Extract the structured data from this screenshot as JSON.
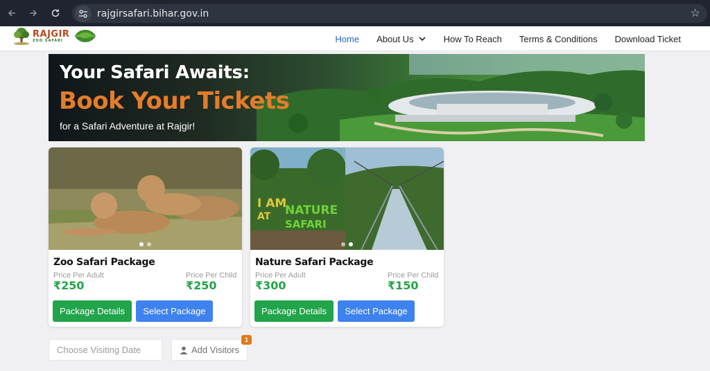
{
  "browser": {
    "url": "rajgirsafari.bihar.gov.in",
    "back_icon": "arrow-left-icon",
    "forward_icon": "arrow-right-icon",
    "reload_icon": "reload-icon",
    "site_info_icon": "tune-icon",
    "bookmark_icon": "star-icon"
  },
  "header": {
    "logo_main": "RAJGIR",
    "logo_sub": "ZOO SAFARI",
    "nav": [
      {
        "label": "Home",
        "active": true
      },
      {
        "label": "About Us",
        "has_dropdown": true
      },
      {
        "label": "How To Reach"
      },
      {
        "label": "Terms & Conditions"
      },
      {
        "label": "Download Ticket"
      }
    ]
  },
  "banner": {
    "line1": "Your Safari Awaits:",
    "line2": "Book Your Tickets",
    "line3": "for a Safari Adventure at Rajgir!"
  },
  "packages": [
    {
      "title": "Zoo Safari Package",
      "adult_label": "Price Per Adult",
      "adult_price": "₹250",
      "child_label": "Price Per Child",
      "child_price": "₹250",
      "details_button": "Package Details",
      "select_button": "Select Package"
    },
    {
      "title": "Nature Safari Package",
      "adult_label": "Price Per Adult",
      "adult_price": "₹300",
      "child_label": "Price Per Child",
      "child_price": "₹150",
      "details_button": "Package Details",
      "select_button": "Select Package",
      "image_sign_text": "I AM AT NATURE SAFARI RAJGIR BIHAR"
    }
  ],
  "booking": {
    "date_placeholder": "Choose Visiting Date",
    "visitors_label": "Add Visitors",
    "visitors_count": "1",
    "visitors_icon": "user-icon"
  },
  "colors": {
    "accent_orange": "#e47d2a",
    "price_green": "#22a447",
    "details_button": "#21a44a",
    "select_button": "#3d82ee",
    "nav_active": "#2264c8"
  }
}
